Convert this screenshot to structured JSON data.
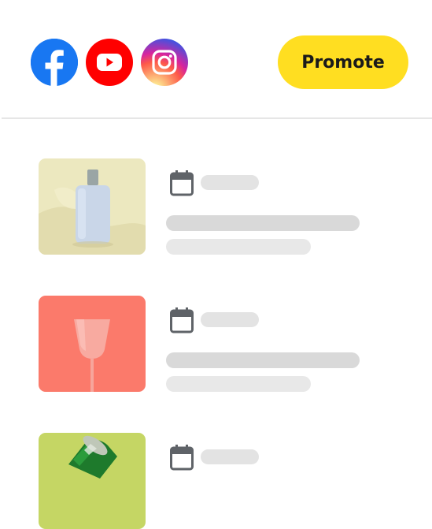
{
  "header": {
    "socials": [
      {
        "name": "facebook-icon",
        "color": "#1877f2"
      },
      {
        "name": "youtube-icon",
        "color": "#ff0000"
      },
      {
        "name": "instagram-icon",
        "color": "#d6249f"
      }
    ],
    "promote_label": "Promote",
    "promote_color": "#ffde21"
  },
  "posts": [
    {
      "thumbnail": "white-bottle-on-yellow",
      "bg": "#ece7bd"
    },
    {
      "thumbnail": "pink-glass-on-coral",
      "bg": "#fb7b6c"
    },
    {
      "thumbnail": "green-can-on-lime",
      "bg": "#c7d864"
    }
  ],
  "icons": {
    "calendar": "calendar-icon"
  }
}
